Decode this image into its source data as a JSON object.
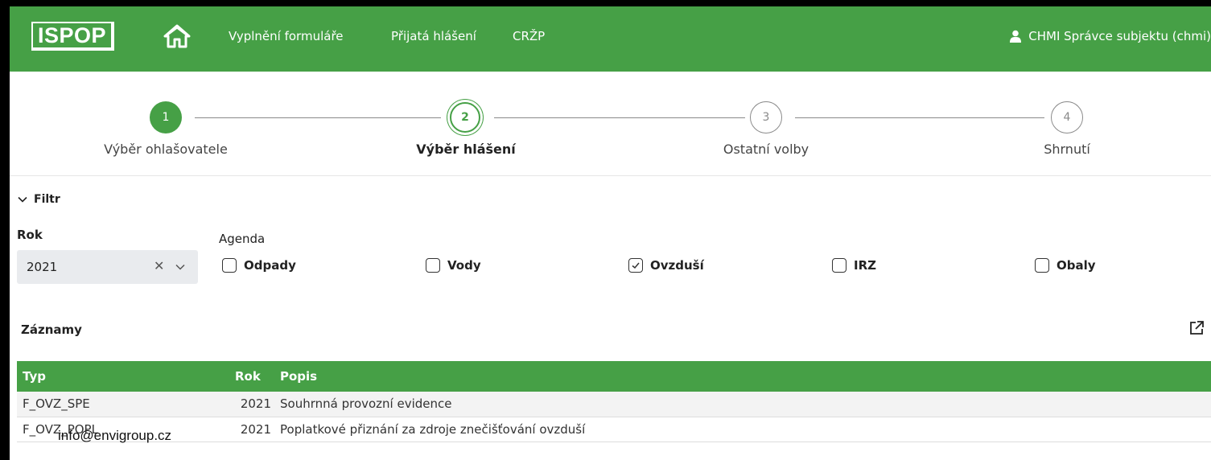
{
  "header": {
    "logo": "ISPOP",
    "nav": [
      "Vyplnění formuláře",
      "Přijatá hlášení",
      "CRŽP"
    ],
    "user": "CHMI Správce subjektu (chmi)"
  },
  "stepper": {
    "steps": [
      {
        "number": "1",
        "label": "Výběr ohlašovatele",
        "state": "done"
      },
      {
        "number": "2",
        "label": "Výběr hlášení",
        "state": "active"
      },
      {
        "number": "3",
        "label": "Ostatní volby",
        "state": "todo"
      },
      {
        "number": "4",
        "label": "Shrnutí",
        "state": "todo"
      }
    ]
  },
  "filter": {
    "toggle_label": "Filtr",
    "rok_label": "Rok",
    "rok_value": "2021",
    "agenda_label": "Agenda",
    "agendas": [
      {
        "label": "Odpady",
        "checked": false
      },
      {
        "label": "Vody",
        "checked": false
      },
      {
        "label": "Ovzduší",
        "checked": true
      },
      {
        "label": "IRZ",
        "checked": false
      },
      {
        "label": "Obaly",
        "checked": false
      }
    ]
  },
  "records": {
    "title": "Záznamy",
    "columns": [
      "Typ",
      "Rok",
      "Popis"
    ],
    "rows": [
      {
        "typ": "F_OVZ_SPE",
        "rok": "2021",
        "popis": "Souhrnná provozní evidence"
      },
      {
        "typ": "F_OVZ_POPL",
        "rok": "2021",
        "popis": "Poplatkové přiznání za zdroje znečišťování ovzduší"
      }
    ]
  },
  "watermark": "info@envigroup.cz",
  "colors": {
    "brand": "#46a046"
  }
}
